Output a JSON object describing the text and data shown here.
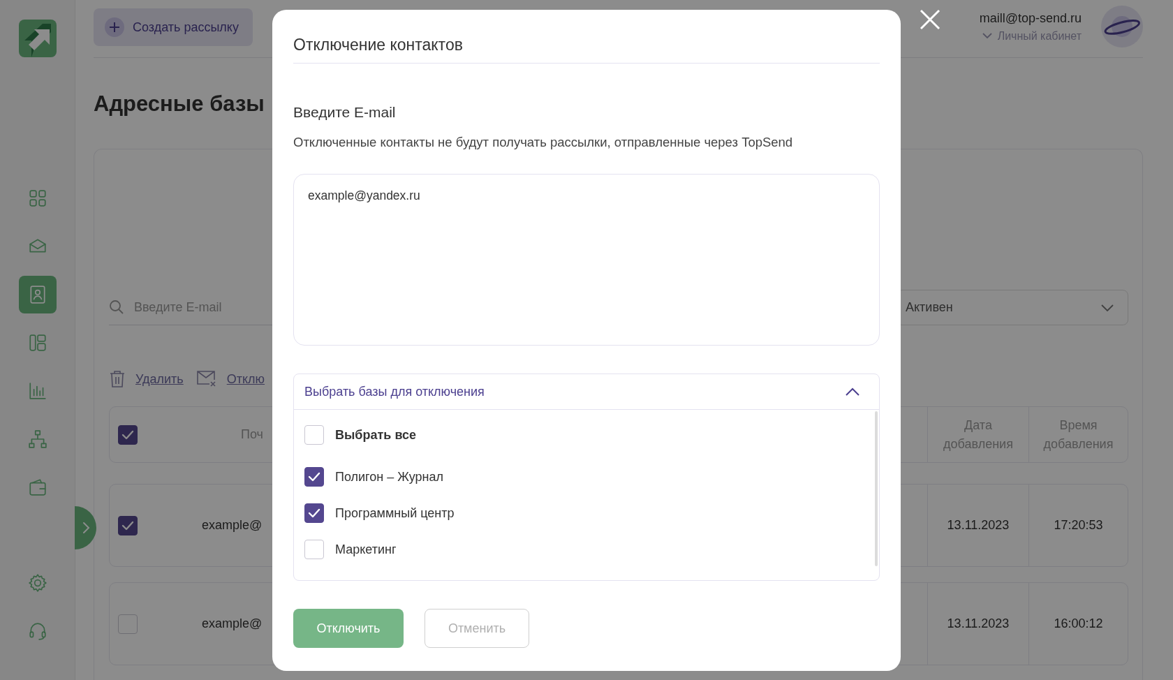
{
  "sidebar": {
    "items": [
      {
        "kind": "dashboard",
        "selected": false
      },
      {
        "kind": "mailings",
        "selected": false
      },
      {
        "kind": "contacts",
        "selected": true
      },
      {
        "kind": "templates",
        "selected": false
      },
      {
        "kind": "stats",
        "selected": false
      },
      {
        "kind": "integrations",
        "selected": false
      },
      {
        "kind": "billing",
        "selected": false
      }
    ],
    "bottom_items": [
      {
        "kind": "settings",
        "selected": false
      },
      {
        "kind": "support",
        "selected": false
      }
    ]
  },
  "header": {
    "create_button": "Создать рассылку",
    "account_email": "maill@top-send.ru",
    "account_link": "Личный кабинет"
  },
  "page_title": "Адресные базы",
  "filters": {
    "search_placeholder": "Введите E-mail",
    "status": "Активен"
  },
  "actions": [
    {
      "kind": "delete",
      "label": "Удалить"
    },
    {
      "kind": "disable",
      "label": "Отклю"
    }
  ],
  "table": {
    "select_all_checked": true,
    "columns": [
      "Поч",
      "Дата добавления",
      "Время добавления"
    ],
    "rows": [
      {
        "checked": true,
        "email": "example@",
        "date": "13.11.2023",
        "time": "17:20:53"
      },
      {
        "checked": false,
        "email": "example@",
        "date": "13.11.2023",
        "time": "16:00:12"
      }
    ]
  },
  "modal": {
    "title": "Отключение контактов",
    "field_label": "Введите E-mail",
    "hint": "Отключенные контакты не будут получать рассылки, отправленные через TopSend",
    "email_value": "example@yandex.ru",
    "dropdown": {
      "label": "Выбрать базы для отключения",
      "expanded": true,
      "options": [
        {
          "kind": "all",
          "label": "Выбрать все",
          "checked": false
        },
        {
          "kind": "base",
          "label": "Полигон – Журнал",
          "checked": true
        },
        {
          "kind": "base",
          "label": "Программный центр",
          "checked": true
        },
        {
          "kind": "base",
          "label": "Маркетинг",
          "checked": false
        }
      ]
    },
    "buttons": [
      {
        "kind": "primary",
        "label": "Отключить"
      },
      {
        "kind": "secondary",
        "label": "Отменить"
      }
    ]
  }
}
